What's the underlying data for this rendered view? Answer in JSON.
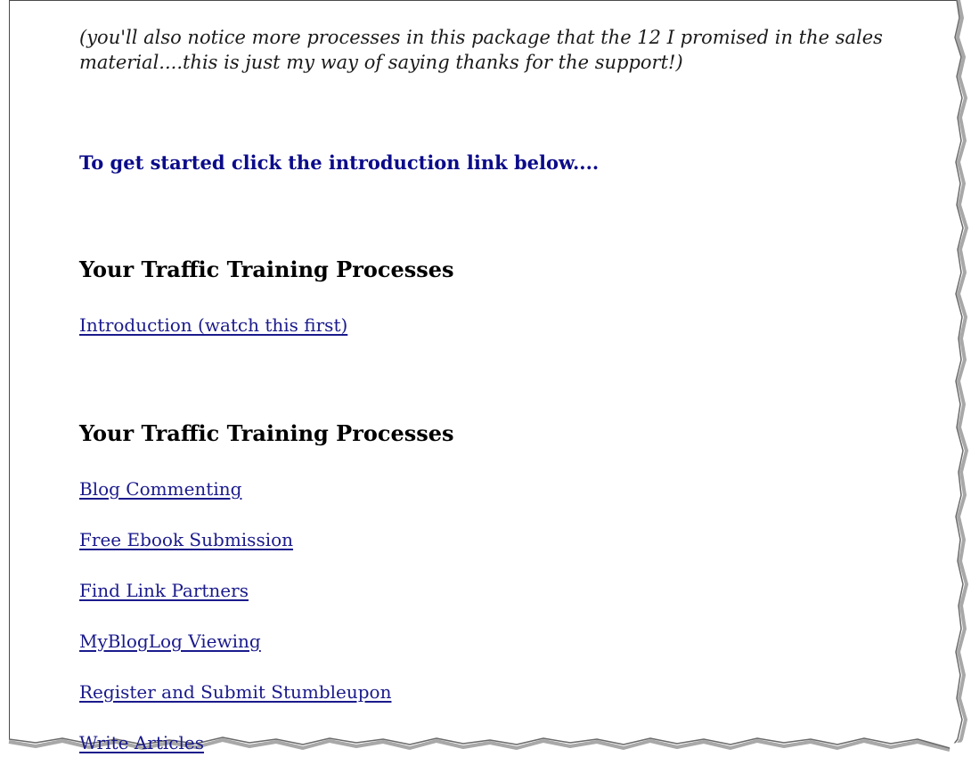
{
  "document": {
    "intro_note": "(you'll also notice more processes in this package that the 12 I promised in the sales material....this is just my way of saying thanks for the support!)",
    "cta": "To get started click the introduction link below....",
    "sections": [
      {
        "heading": "Your Traffic Training Processes",
        "links": [
          "Introduction (watch this first)"
        ]
      },
      {
        "heading": "Your Traffic Training Processes",
        "links": [
          "Blog Commenting",
          "Free Ebook Submission",
          "Find Link Partners",
          "MyBlogLog Viewing",
          "Register and Submit Stumbleupon",
          "Write Articles"
        ]
      }
    ]
  },
  "colors": {
    "link": "#1a1a8c",
    "cta": "#0b0b8a",
    "text": "#1a1a1a",
    "frame_border": "#4a4a4a",
    "torn_edge_shadow": "#9a9a9a"
  }
}
